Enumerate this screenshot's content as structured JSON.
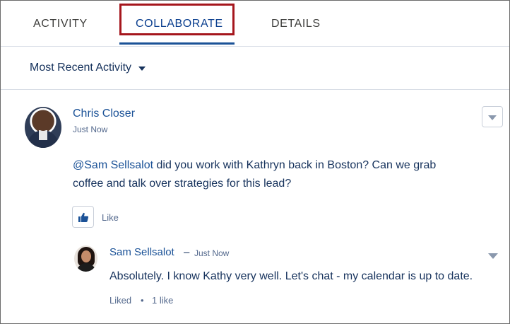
{
  "tabs": [
    {
      "label": "ACTIVITY"
    },
    {
      "label": "COLLABORATE"
    },
    {
      "label": "DETAILS"
    }
  ],
  "filter": {
    "label": "Most Recent Activity"
  },
  "post": {
    "author": "Chris Closer",
    "time": "Just Now",
    "mention": "@Sam Sellsalot",
    "text_line1_rest": " did you work with Kathryn back in Boston? Can we grab",
    "text_line2": "coffee and talk over strategies for this lead?",
    "like_label": "Like"
  },
  "comment": {
    "author": "Sam Sellsalot",
    "dash": "–",
    "time": "Just Now",
    "text": "Absolutely. I know Kathy very well. Let's chat - my calendar is up to date.",
    "liked": "Liked",
    "dot": "•",
    "likes": "1 like"
  },
  "colors": {
    "accent": "#1b5297",
    "highlight": "#a5161d",
    "text": "#16325c"
  }
}
